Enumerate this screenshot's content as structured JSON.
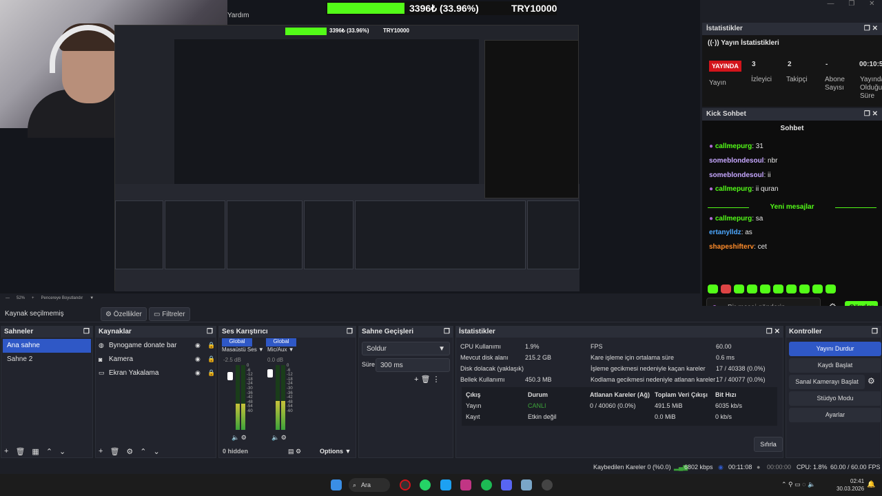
{
  "preview": {
    "menu_tail": "Yardım",
    "donation_amount": "3396₺ (33.96%)",
    "donation_goal": "TRY10000",
    "donation_progress": 0.3396,
    "zoom": "52%",
    "fit_mode": "Pencereye Boyutlandır"
  },
  "stats_dock": {
    "header": "İstatistikler",
    "title": "Yayın İstatistikleri",
    "live_badge": "YAYINDA",
    "live_label": "Yayın",
    "viewers_value": "3",
    "viewers_label": "İzleyici",
    "followers_value": "2",
    "followers_label": "Takipçi",
    "subs_value": "-",
    "subs_label": "Abone Sayısı",
    "duration_value": "00:10:5",
    "duration_label": "Yayında Olduğu Süre"
  },
  "kick_dock": {
    "header": "Kick Sohbet",
    "subtitle": "Sohbet",
    "messages": [
      {
        "user": "callmepurg",
        "text": "31",
        "color": "#53fc18"
      },
      {
        "user": "someblondesoul",
        "text": "nbr",
        "color": "#c6a7ff"
      },
      {
        "user": "someblondesoul",
        "text": "ii",
        "color": "#c6a7ff"
      },
      {
        "user": "callmepurg",
        "text": "ii quran",
        "color": "#53fc18"
      },
      {
        "user": "callmepurg",
        "text": "sa",
        "color": "#53fc18"
      },
      {
        "user": "ertanylldz",
        "text": "as",
        "color": "#4da8ff"
      },
      {
        "user": "shapeshifterv",
        "text": "cet",
        "color": "#ff8c2a"
      }
    ],
    "new_messages": "Yeni mesajlar",
    "input_placeholder": "Bir mesaj gönderin",
    "send_label": "Gönder"
  },
  "source_bar": {
    "status": "Kaynak seçilmemiş",
    "properties": "Özellikler",
    "filters": "Filtreler"
  },
  "scenes": {
    "header": "Sahneler",
    "items": [
      "Ana sahne",
      "Sahne 2"
    ]
  },
  "sources": {
    "header": "Kaynaklar",
    "items": [
      {
        "label": "Bynogame donate bar",
        "icon": "globe-icon"
      },
      {
        "label": "Kamera",
        "icon": "camera-icon"
      },
      {
        "label": "Ekran Yakalama",
        "icon": "monitor-icon"
      }
    ]
  },
  "mixer": {
    "header": "Ses Karıştırıcı",
    "ch1_tag": "Global",
    "ch1_name": "Masaüstü Ses",
    "ch1_db": "-2.5 dB",
    "ch1_level": 0.4,
    "ch2_tag": "Global",
    "ch2_name": "Mic/Aux",
    "ch2_db": "0.0 dB",
    "ch2_level": 0.45,
    "scale": [
      "0",
      "-6",
      "-12",
      "-18",
      "-24",
      "-30",
      "-36",
      "-42",
      "-48",
      "-54",
      "-60"
    ],
    "hidden": "0 hidden",
    "options": "Options"
  },
  "transitions": {
    "header": "Sahne Geçişleri",
    "type": "Soldur",
    "duration_label": "Süre",
    "duration_value": "300 ms"
  },
  "stats": {
    "header": "İstatistikler",
    "rows_left": [
      {
        "label": "CPU Kullanımı",
        "value": "1.9%"
      },
      {
        "label": "Mevcut disk alanı",
        "value": "215.2 GB"
      },
      {
        "label": "Disk dolacak (yaklaşık)",
        "value": ""
      },
      {
        "label": "Bellek Kullanımı",
        "value": "450.3 MB"
      }
    ],
    "rows_right": [
      {
        "label": "FPS",
        "value": "60.00"
      },
      {
        "label": "Kare işleme için ortalama süre",
        "value": "0.6 ms"
      },
      {
        "label": "İşleme gecikmesi nedeniyle kaçan kareler",
        "value": "17 / 40338 (0.0%)"
      },
      {
        "label": "Kodlama gecikmesi nedeniyle atlanan kareler",
        "value": "17 / 40077 (0.0%)"
      }
    ],
    "table_headers": [
      "Çıkış",
      "Durum",
      "Atlanan Kareler (Ağ)",
      "Toplam Veri Çıkışı",
      "Bit Hızı"
    ],
    "table_rows": [
      [
        "Yayın",
        "CANLI",
        "0 / 40060 (0.0%)",
        "491.5 MiB",
        "6035 kb/s"
      ],
      [
        "Kayıt",
        "Etkin değil",
        "",
        "0.0 MiB",
        "0 kb/s"
      ]
    ],
    "reset": "Sıfırla"
  },
  "controls": {
    "header": "Kontroller",
    "stop_stream": "Yayını Durdur",
    "start_record": "Kaydı Başlat",
    "virtual_cam": "Sanal Kamerayı Başlat",
    "studio_mode": "Stüdyo Modu",
    "settings": "Ayarlar"
  },
  "statusbar": {
    "dropped": "Kaybedilen Kareler 0 (%0.0)",
    "bitrate": "6802 kbps",
    "stream_time": "00:11:08",
    "rec_time": "00:00:00",
    "cpu": "CPU: 1.8%",
    "fps": "60.00 / 60.00 FPS"
  },
  "taskbar": {
    "search": "Ara",
    "time": "02:41",
    "date": "30.03.2026"
  },
  "colors": {
    "accent": "#2f58c6",
    "kick_green": "#53fc18",
    "live_red": "#d3141b"
  }
}
